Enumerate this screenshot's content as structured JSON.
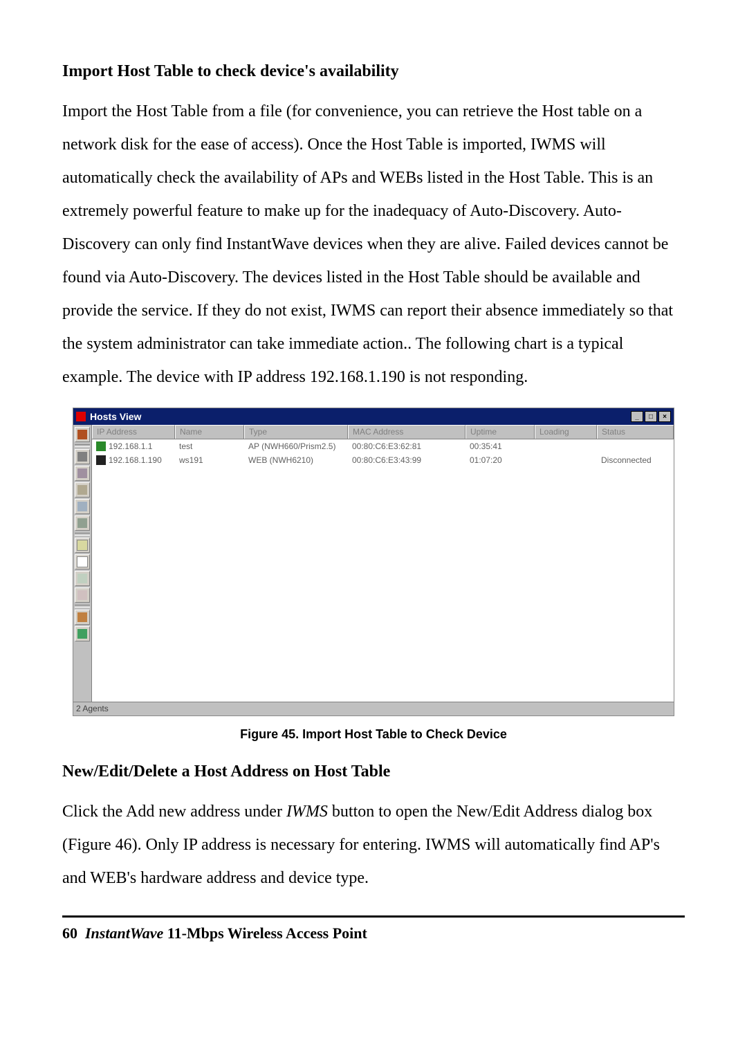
{
  "section1_heading": "Import Host Table to check device's availability",
  "section1_body": "Import the Host Table from a file (for convenience, you can retrieve the Host table on a network disk for the ease of access). Once the Host Table is imported, IWMS will automatically check the availability of APs and WEBs listed in the Host Table. This is an extremely powerful feature to make up for the inadequacy of Auto-Discovery. Auto-Discovery can only find InstantWave devices when they are alive. Failed devices cannot be found via Auto-Discovery. The devices listed in the Host Table should be available and provide the service. If they do not exist, IWMS can report their absence immediately so that the system administrator can take immediate action.. The following chart is a typical example. The device with IP address 192.168.1.190 is not responding.",
  "figure_caption": "Figure 45.  Import Host Table to Check Device",
  "section2_heading": "New/Edit/Delete a Host Address on Host Table",
  "section2_pre": "Click the Add new address under ",
  "section2_italic": "IWMS",
  "section2_post": " button to open the New/Edit Address dialog box (Figure 46). Only IP address is necessary for entering. IWMS will automatically find AP's and WEB's hardware address and device type.",
  "footer": {
    "page": "60",
    "doc_title_italic": "InstantWave",
    "doc_title_rest": " 11-Mbps Wireless Access Point"
  },
  "hosts_window": {
    "title": "Hosts View",
    "columns": {
      "ip": "IP Address",
      "name": "Name",
      "type": "Type",
      "mac": "MAC Address",
      "uptime": "Uptime",
      "loading": "Loading",
      "status": "Status"
    },
    "rows": [
      {
        "icon": "green",
        "ip": "192.168.1.1",
        "name": "test",
        "type": "AP (NWH660/Prism2.5)",
        "mac": "00:80:C6:E3:62:81",
        "uptime": "00:35:41",
        "loading": "",
        "status": ""
      },
      {
        "icon": "black",
        "ip": "192.168.1.190",
        "name": "ws191",
        "type": "WEB (NWH6210)",
        "mac": "00:80:C6:E3:43:99",
        "uptime": "01:07:20",
        "loading": "",
        "status": "Disconnected"
      }
    ],
    "statusbar": "2 Agents"
  }
}
